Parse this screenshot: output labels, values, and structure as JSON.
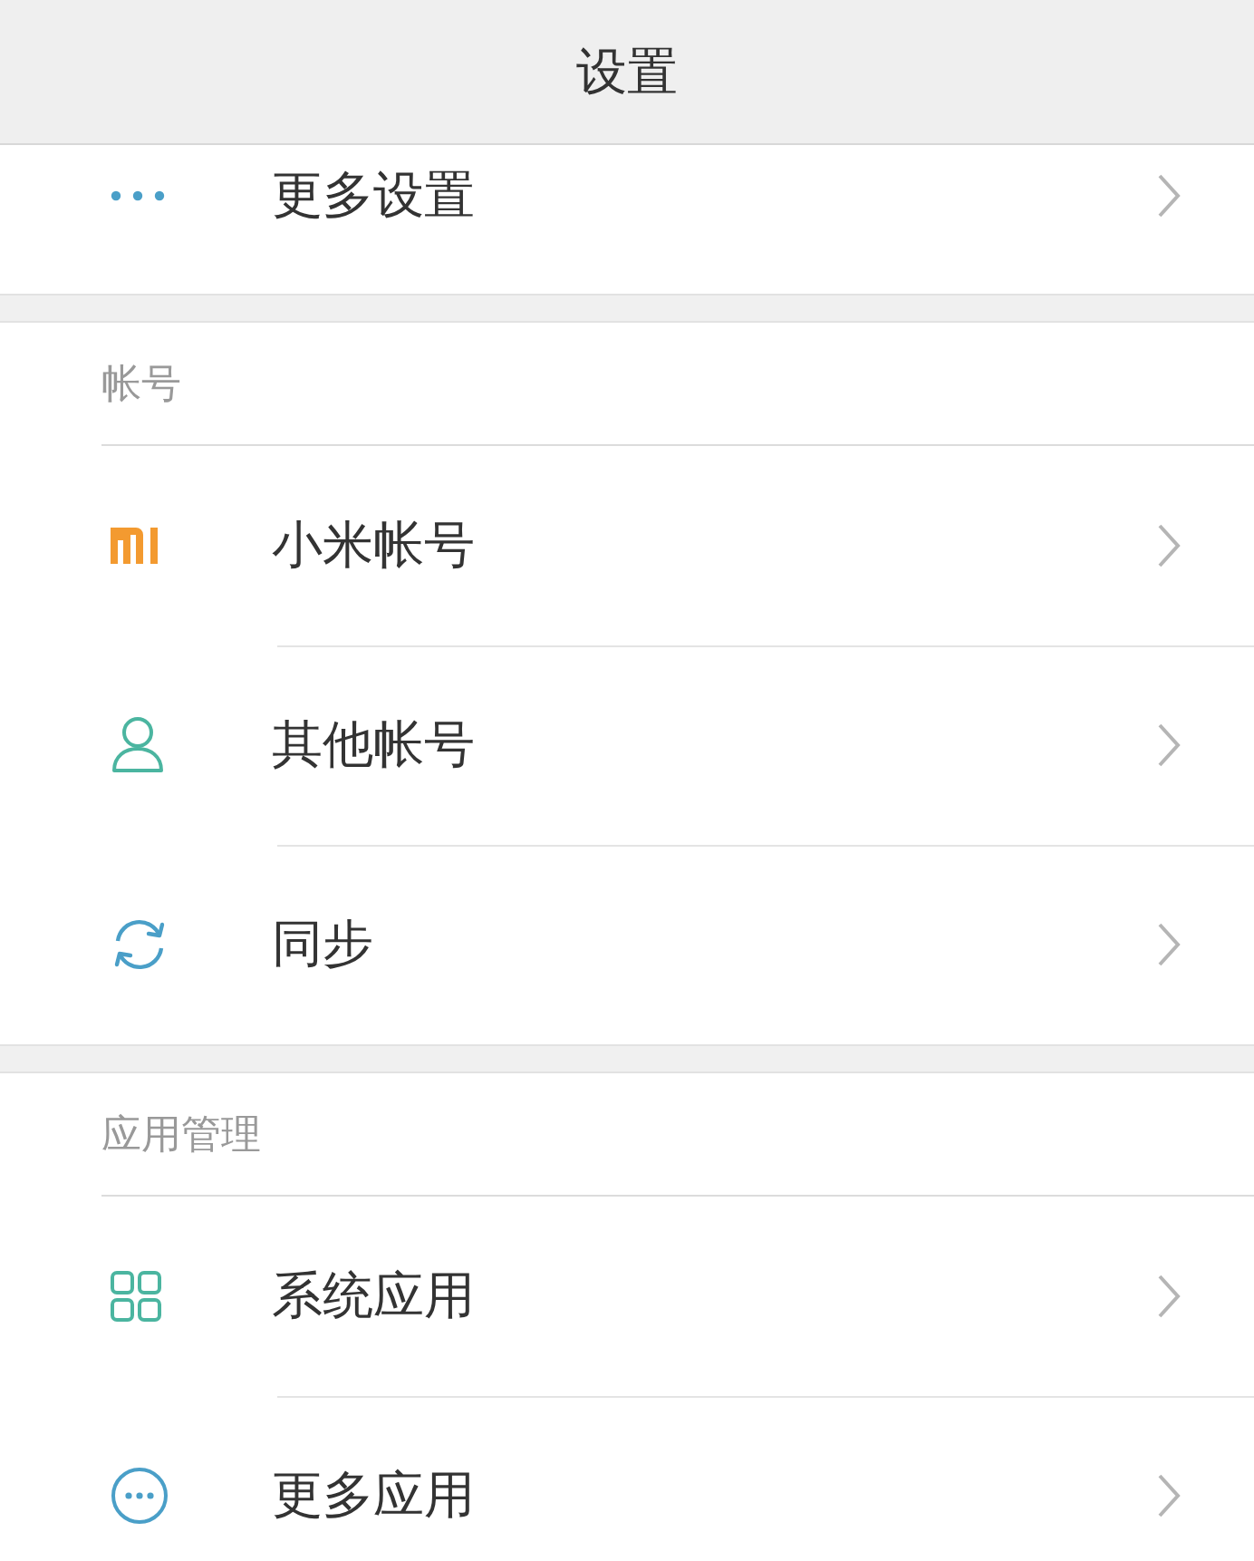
{
  "header": {
    "title": "设置"
  },
  "sections": [
    {
      "items": [
        {
          "label": "更多设置"
        }
      ]
    },
    {
      "title": "帐号",
      "items": [
        {
          "label": "小米帐号"
        },
        {
          "label": "其他帐号"
        },
        {
          "label": "同步"
        }
      ]
    },
    {
      "title": "应用管理",
      "items": [
        {
          "label": "系统应用"
        },
        {
          "label": "更多应用"
        }
      ]
    }
  ]
}
